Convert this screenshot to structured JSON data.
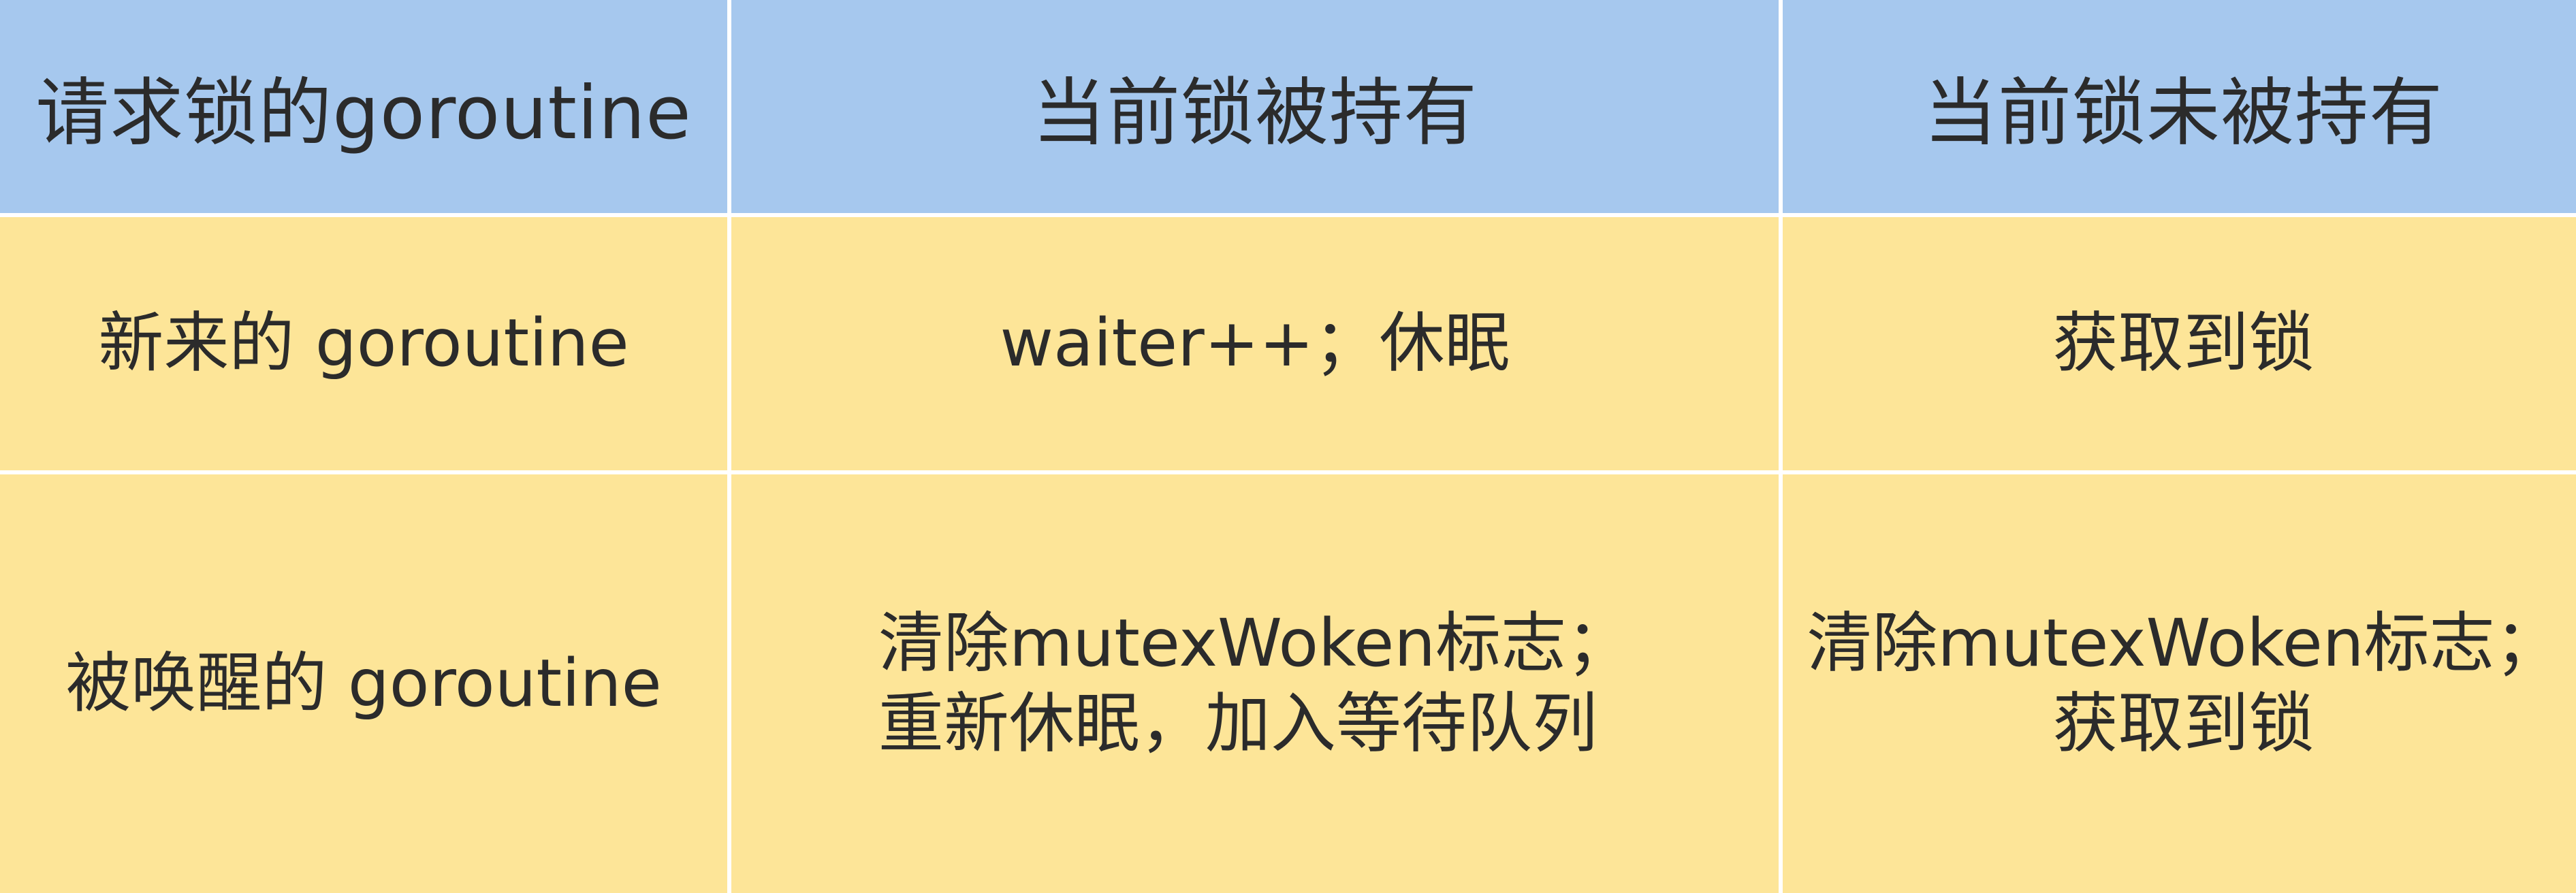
{
  "table": {
    "headers": [
      "请求锁的goroutine",
      "当前锁被持有",
      "当前锁未被持有"
    ],
    "rows": [
      {
        "label": "新来的 goroutine",
        "held": [
          "waiter++；休眠"
        ],
        "not_held": [
          "获取到锁"
        ]
      },
      {
        "label": "被唤醒的 goroutine",
        "held": [
          "清除mutexWoken标志；",
          "重新休眠，加入等待队列"
        ],
        "not_held": [
          "清除mutexWoken标志；",
          "获取到锁"
        ]
      }
    ]
  },
  "colors": {
    "header_background": "#a6c8ee",
    "body_background": "#fde598",
    "grid_lines": "#ffffff",
    "text": "#2b2b2b"
  }
}
